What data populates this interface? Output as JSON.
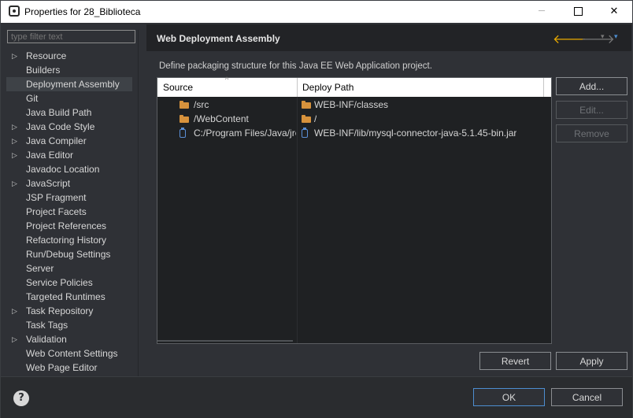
{
  "window": {
    "title": "Properties for 28_Biblioteca",
    "minimize": "─",
    "close": "✕"
  },
  "filter": {
    "placeholder": "type filter text"
  },
  "tree": [
    {
      "label": "Resource",
      "expandable": true
    },
    {
      "label": "Builders",
      "expandable": false
    },
    {
      "label": "Deployment Assembly",
      "expandable": false,
      "selected": true
    },
    {
      "label": "Git",
      "expandable": false
    },
    {
      "label": "Java Build Path",
      "expandable": false
    },
    {
      "label": "Java Code Style",
      "expandable": true
    },
    {
      "label": "Java Compiler",
      "expandable": true
    },
    {
      "label": "Java Editor",
      "expandable": true
    },
    {
      "label": "Javadoc Location",
      "expandable": false
    },
    {
      "label": "JavaScript",
      "expandable": true
    },
    {
      "label": "JSP Fragment",
      "expandable": false
    },
    {
      "label": "Project Facets",
      "expandable": false
    },
    {
      "label": "Project References",
      "expandable": false
    },
    {
      "label": "Refactoring History",
      "expandable": false
    },
    {
      "label": "Run/Debug Settings",
      "expandable": false
    },
    {
      "label": "Server",
      "expandable": false
    },
    {
      "label": "Service Policies",
      "expandable": false
    },
    {
      "label": "Targeted Runtimes",
      "expandable": false
    },
    {
      "label": "Task Repository",
      "expandable": true
    },
    {
      "label": "Task Tags",
      "expandable": false
    },
    {
      "label": "Validation",
      "expandable": true
    },
    {
      "label": "Web Content Settings",
      "expandable": false
    },
    {
      "label": "Web Page Editor",
      "expandable": false
    }
  ],
  "page": {
    "title": "Web Deployment Assembly",
    "description": "Define packaging structure for this Java EE Web Application project.",
    "nav": {
      "back": "🡐",
      "forward": "🡒",
      "menu": "▾"
    }
  },
  "table": {
    "columns": [
      "Source",
      "Deploy Path"
    ],
    "rows": [
      {
        "source": "/src",
        "deploy": "WEB-INF/classes",
        "icon": "folder"
      },
      {
        "source": "/WebContent",
        "deploy": "/",
        "icon": "folder"
      },
      {
        "source": "C:/Program Files/Java/jre",
        "deploy": "WEB-INF/lib/mysql-connector-java-5.1.45-bin.jar",
        "icon": "jar"
      }
    ]
  },
  "buttons": {
    "add": "Add...",
    "edit": "Edit...",
    "remove": "Remove",
    "revert": "Revert",
    "apply": "Apply",
    "ok": "OK",
    "cancel": "Cancel",
    "help": "?"
  },
  "colors": {
    "background": "#2f3136",
    "accent": "#4d8ed1",
    "back_arrow": "#e8a900",
    "folder": "#d7923c"
  }
}
